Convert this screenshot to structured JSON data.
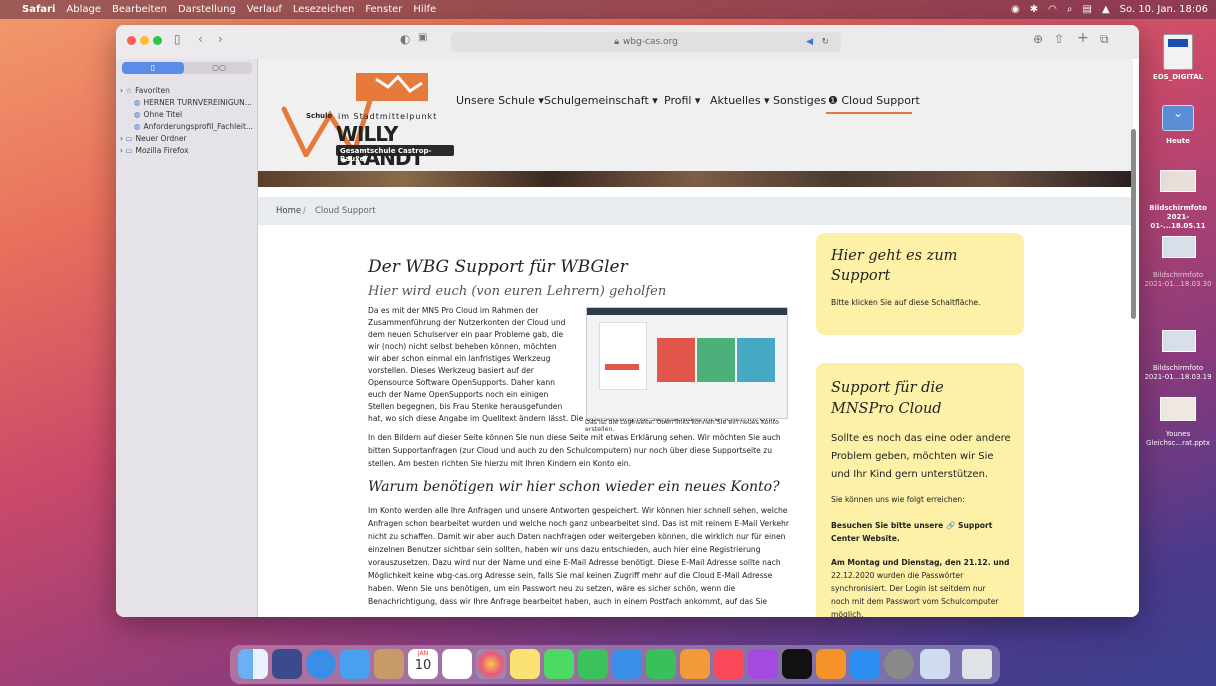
{
  "menubar": {
    "app": "Safari",
    "items": [
      "Ablage",
      "Bearbeiten",
      "Darstellung",
      "Verlauf",
      "Lesezeichen",
      "Fenster",
      "Hilfe"
    ],
    "datetime": "So. 10. Jan. 18:06"
  },
  "browser": {
    "url": "wbg-cas.org"
  },
  "sidebar": {
    "favorites_label": "Favoriten",
    "items": [
      "HERNER TURNVEREINIGUN...",
      "Ohne Titel",
      "Anforderungsprofil_Fachleit..."
    ],
    "folders": [
      "Neuer Ordner",
      "Mozilla Firefox"
    ]
  },
  "site": {
    "logo": {
      "schule": "Schule",
      "im_stadtmittelpunkt": "im Stadtmittelpunkt",
      "name": "WILLY BRANDT",
      "subtitle": "Gesamtschule Castrop-Rauxel"
    },
    "nav": [
      "Unsere Schule",
      "Schulgemeinschaft",
      "Profil",
      "Aktuelles",
      "Sonstiges"
    ],
    "nav_active": "Cloud Support",
    "breadcrumb": {
      "home": "Home",
      "separator": "/",
      "current": "Cloud Support"
    }
  },
  "article": {
    "title": "Der WBG Support für WBGler",
    "subtitle": "Hier wird euch (von euren Lehrern) geholfen",
    "intro_lines": [
      "Da es mit der MNS Pro Cloud im Rahmen der",
      "Zusammenführung der Nutzerkonten der Cloud und",
      "dem neuen Schulserver ein paar Probleme gab, die",
      "wir (noch) nicht selbst beheben können, möchten",
      "wir aber schon einmal ein lanfristiges Werkzeug",
      "vorstellen. Dieses Werkzeug basiert auf der",
      "Opensource Software OpenSupports. Daher kann",
      "euch der Name OpenSupports noch ein einigen",
      "Stellen begegnen, bis Frau Stenke herausgefunden",
      "hat, wo sich diese Angabe im Quelltext ändern lässt. Die Übersetzung hat sie jedenfalls inzwischen im Griff."
    ],
    "caption": "Das ist die Loginseite. Oben links können Sie ein neues Konto erstellen.",
    "para2_lines": [
      "In den Bildern auf dieser Seite können Sie nun diese Seite mit etwas Erklärung sehen. Wir möchten Sie auch",
      "bitten Supportanfragen (zur Cloud und auch zu den Schulcomputern) nur noch über diese Supportseite zu",
      "stellen. Am besten richten Sie hierzu mit Ihren Kindern ein Konto ein."
    ],
    "heading2": "Warum benötigen wir hier schon wieder ein neues Konto?",
    "para3_lines": [
      "Im Konto werden alle Ihre Anfragen und unsere Antworten gespeichert. Wir können hier schnell sehen, welche",
      "Anfragen schon bearbeitet wurden und welche noch ganz unbearbeitet sind. Das ist mit reinem E-Mail Verkehr",
      "nicht zu schaffen. Damit wir aber auch Daten nachfragen oder weitergeben können, die wirklich nur für einen",
      "einzelnen Benutzer sichtbar sein sollten, haben wir uns dazu entschieden, auch hier eine Registrierung",
      "vorauszusetzen. Dazu wird nur der Name und eine E-Mail Adresse benötigt. Diese E-Mail Adresse sollte nach",
      "Möglichkeit keine wbg-cas.org Adresse sein, falls Sie mal keinen Zugriff mehr auf die Cloud E-Mail Adresse",
      "haben. Wenn Sie uns benötigen, um ein Passwort neu zu setzen, wäre es sicher schön, wenn die",
      "Benachrichtigung, dass wir Ihre Anfrage bearbeitet haben, auch in einem Postfach ankommt, auf das Sie"
    ]
  },
  "cards": {
    "support": {
      "title_lines": [
        "Hier geht es zum",
        "Support"
      ],
      "text": "Bitte klicken Sie auf diese Schaltfläche."
    },
    "mnspro": {
      "title_lines": [
        "Support für die",
        "MNSPro Cloud"
      ],
      "big_lines": [
        "Sollte es noch das eine oder andere",
        "Problem geben, möchten wir Sie",
        "und Ihr Kind gern unterstützen."
      ],
      "reach": "Sie können uns wie folgt erreichen:",
      "link_lines": [
        "Besuchen Sie bitte unsere 🔗 Support",
        "Center Website."
      ],
      "note_lines": [
        "Am Montag und Dienstag, den 21.12. und",
        "22.12.2020 wurden die Passwörter",
        "synchronisiert. Der Login ist seitdem nur",
        "noch mit dem Passwort vom Schulcomputer",
        "möglich."
      ]
    }
  },
  "desktop": {
    "icons": [
      "EOS_DIGITAL",
      "Heute",
      "Bildschirmfoto 2021-01-...18.05.11",
      "Bildschirmfoto 2021-01...18.03.30",
      "Bildschirmfoto 2021-01...18.03.19",
      "Younes Gleichsc...rat.pptx"
    ]
  },
  "dock": {
    "calendar_month": "JAN",
    "calendar_day": "10"
  }
}
